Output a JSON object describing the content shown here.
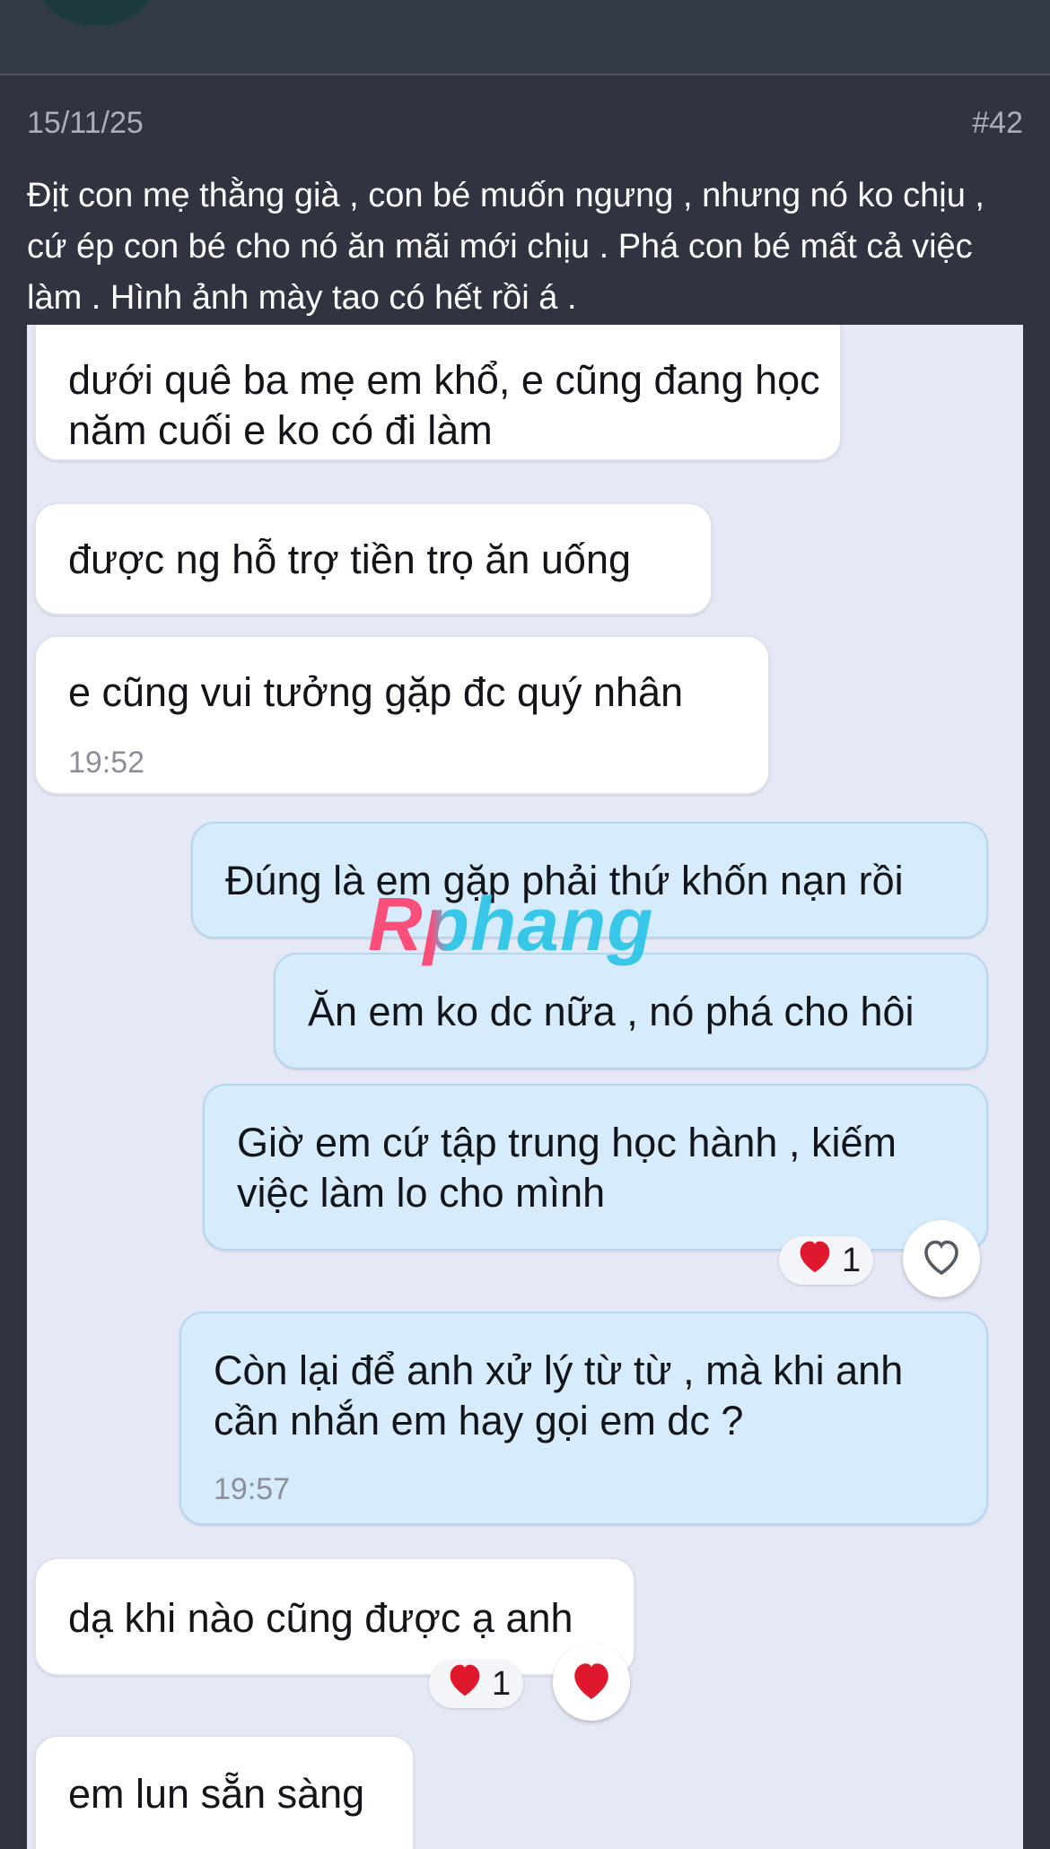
{
  "post": {
    "date": "15/11/25",
    "number": "#42",
    "text": "Địt con mẹ thằng già , con bé muốn ngưng , nhưng nó ko chịu , cứ ép con bé cho nó ăn mãi mới chịu . Phá con bé mất cả việc làm . Hình ảnh mày tao có hết rồi á ."
  },
  "chat": {
    "watermark": "Rphang",
    "messages": [
      {
        "text": "dưới quê ba mẹ em khổ, e cũng đang học năm cuối e ko có đi làm"
      },
      {
        "text": "được ng hỗ trợ tiền trọ ăn uống"
      },
      {
        "text": "e cũng vui tưởng gặp đc quý nhân",
        "time": "19:52"
      },
      {
        "text": "Đúng là em gặp phải thứ khốn nạn rồi"
      },
      {
        "text": "Ăn em ko dc nữa , nó phá cho hôi"
      },
      {
        "text": "Giờ em cứ tập trung học hành , kiếm việc làm lo cho mình",
        "reaction_count": "1"
      },
      {
        "text": "Còn lại để anh xử lý từ từ , mà khi anh cần nhắn em hay gọi em dc ?",
        "time": "19:57"
      },
      {
        "text": "dạ khi nào cũng được ạ anh",
        "reaction_count": "1"
      },
      {
        "text": "em lun sẵn sàng"
      }
    ]
  },
  "colors": {
    "background": "#2f3440",
    "chat_background": "#e5e8f5",
    "sent_bubble": "#d6ecfd",
    "received_bubble": "#ffffff",
    "heart": "#e0182d"
  }
}
